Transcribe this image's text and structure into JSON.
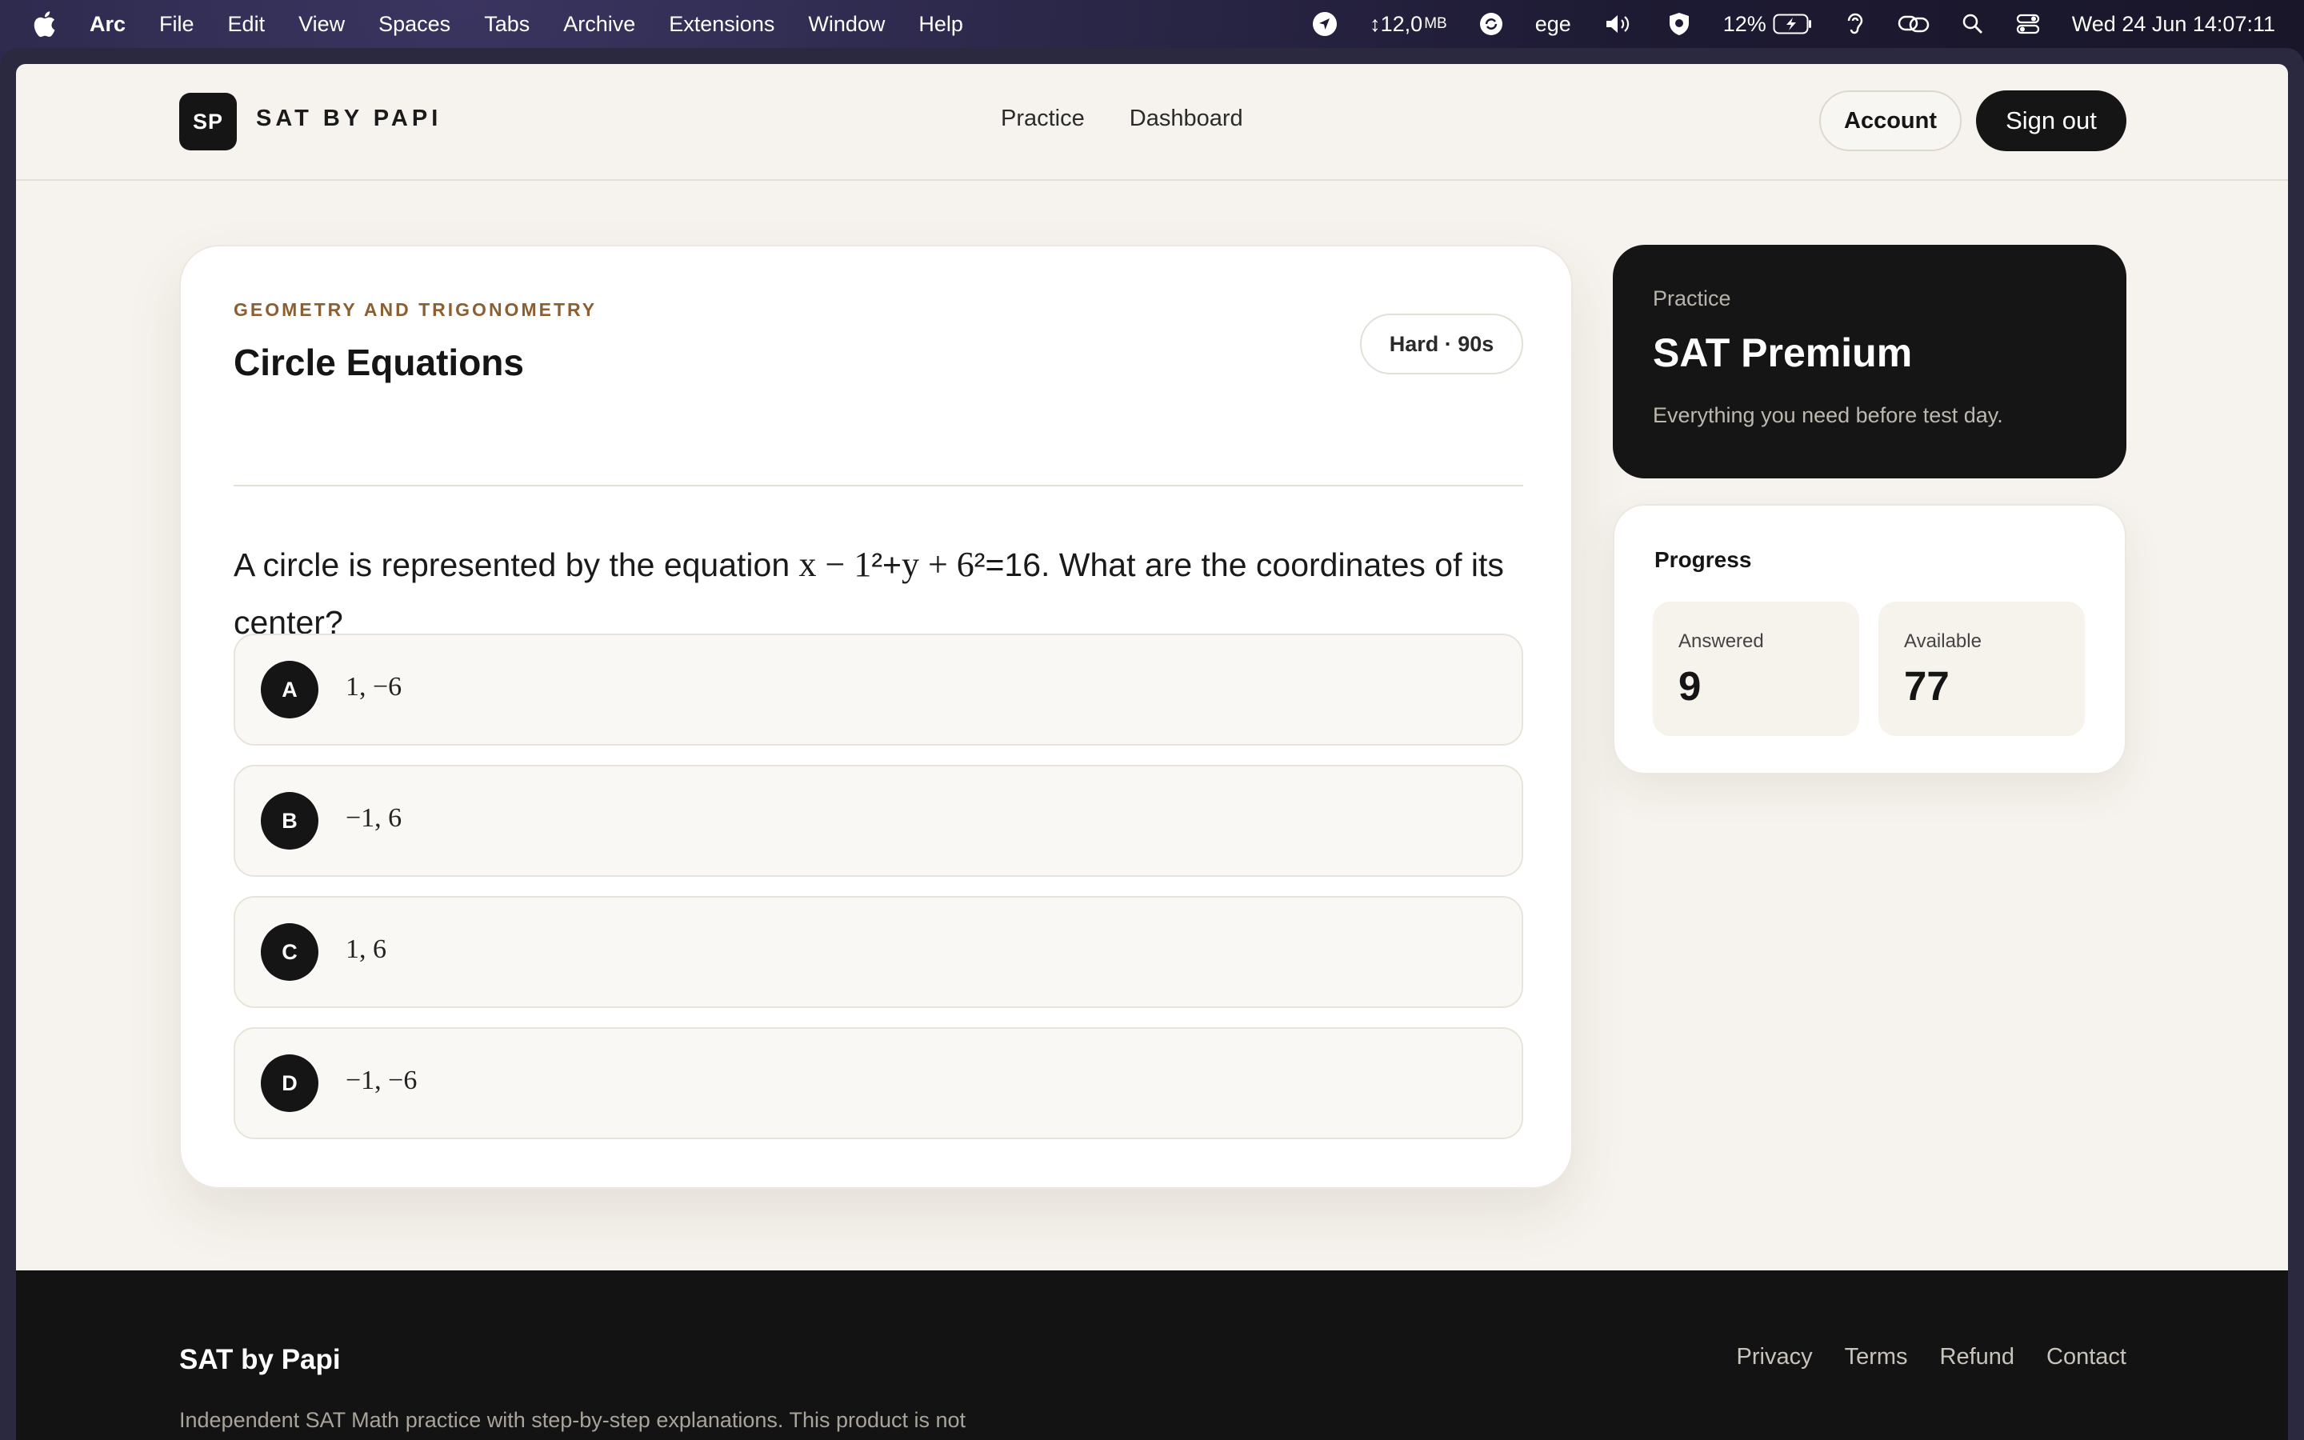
{
  "menubar": {
    "app_name": "Arc",
    "menus": [
      "File",
      "Edit",
      "View",
      "Spaces",
      "Tabs",
      "Archive",
      "Extensions",
      "Window",
      "Help"
    ],
    "network": "↕12,0",
    "network_unit": "MB",
    "keyboard_layout": "ege",
    "battery": "12%",
    "datetime": "Wed 24 Jun  14:07:11"
  },
  "header": {
    "logo_initials": "SP",
    "brand": "SAT BY PAPI",
    "nav": [
      "Practice",
      "Dashboard"
    ],
    "account_label": "Account",
    "signout_label": "Sign out"
  },
  "question": {
    "category": "GEOMETRY AND TRIGONOMETRY",
    "title": "Circle Equations",
    "difficulty": "Hard · 90s",
    "text_before": "A circle is represented by the equation ",
    "math_part1": "x − 1",
    "sup1": "²",
    "plus": "+",
    "math_part2": "y + 6",
    "sup2": "²",
    "text_after": "=16. What are the coordinates of its center?",
    "choices": [
      {
        "letter": "A",
        "value": "1, −6"
      },
      {
        "letter": "B",
        "value": "−1, 6"
      },
      {
        "letter": "C",
        "value": "1, 6"
      },
      {
        "letter": "D",
        "value": "−1, −6"
      }
    ]
  },
  "sidebar": {
    "premium": {
      "eyebrow": "Practice",
      "title": "SAT Premium",
      "subtitle": "Everything you need before test day."
    },
    "progress": {
      "title": "Progress",
      "answered_label": "Answered",
      "answered_value": "9",
      "available_label": "Available",
      "available_value": "77"
    }
  },
  "footer": {
    "brand": "SAT by Papi",
    "links": [
      "Privacy",
      "Terms",
      "Refund",
      "Contact"
    ],
    "note": "Independent SAT Math practice with step-by-step explanations. This product is not"
  }
}
